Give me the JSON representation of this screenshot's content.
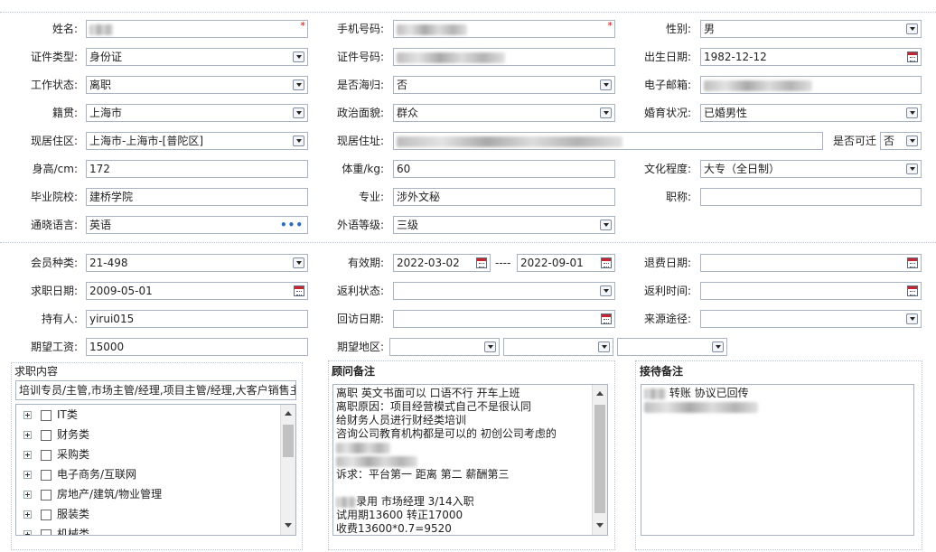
{
  "personal": {
    "name": {
      "label": "姓名:",
      "required_mark": "*"
    },
    "phone": {
      "label": "手机号码:",
      "required_mark": "*"
    },
    "gender": {
      "label": "性别:",
      "value": "男"
    },
    "id_type": {
      "label": "证件类型:",
      "value": "身份证"
    },
    "id_number": {
      "label": "证件号码:"
    },
    "birth_date": {
      "label": "出生日期:",
      "value": "1982-12-12"
    },
    "work_status": {
      "label": "工作状态:",
      "value": "离职"
    },
    "overseas_return": {
      "label": "是否海归:",
      "value": "否"
    },
    "email": {
      "label": "电子邮箱:"
    },
    "native_place": {
      "label": "籍贯:",
      "value": "上海市"
    },
    "political": {
      "label": "政治面貌:",
      "value": "群众"
    },
    "marital": {
      "label": "婚育状况:",
      "value": "已婚男性"
    },
    "residence_area": {
      "label": "现居住区:",
      "value": "上海市-上海市-[普陀区]"
    },
    "residence_address": {
      "label": "现居住址:"
    },
    "relocatable": {
      "label": "是否可迁",
      "value": "否"
    },
    "height": {
      "label": "身高/cm:",
      "value": "172"
    },
    "weight": {
      "label": "体重/kg:",
      "value": "60"
    },
    "education": {
      "label": "文化程度:",
      "value": "大专（全日制）"
    },
    "school": {
      "label": "毕业院校:",
      "value": "建桥学院"
    },
    "major": {
      "label": "专业:",
      "value": "涉外文秘"
    },
    "title": {
      "label": "职称:",
      "value": ""
    },
    "language": {
      "label": "通晓语言:",
      "value": "英语"
    },
    "language_level": {
      "label": "外语等级:",
      "value": "三级"
    }
  },
  "membership": {
    "member_type": {
      "label": "会员种类:",
      "value": "21-498"
    },
    "validity": {
      "label": "有效期:",
      "start": "2022-03-02",
      "separator": "----",
      "end": "2022-09-01"
    },
    "refund_date": {
      "label": "退费日期:",
      "value": ""
    },
    "job_date": {
      "label": "求职日期:",
      "value": "2009-05-01"
    },
    "rebate_status": {
      "label": "返利状态:",
      "value": ""
    },
    "rebate_time": {
      "label": "返利时间:",
      "value": ""
    },
    "holder": {
      "label": "持有人:",
      "value": "yirui015"
    },
    "visit_date": {
      "label": "回访日期:",
      "value": ""
    },
    "source": {
      "label": "来源途径:",
      "value": ""
    },
    "expected_salary": {
      "label": "期望工资:",
      "value": "15000"
    },
    "expected_area": {
      "label": "期望地区:"
    }
  },
  "job_content": {
    "title": "求职内容",
    "summary": "培训专员/主管,市场主管/经理,项目主管/经理,大客户销售主",
    "tree": [
      "IT类",
      "财务类",
      "采购类",
      "电子商务/互联网",
      "房地产/建筑/物业管理",
      "服装类",
      "机械类"
    ]
  },
  "consultant_notes": {
    "title": "顾问备注",
    "lines": [
      "离职 英文书面可以 口语不行  开车上班",
      "离职原因：项目经营模式自己不是很认同",
      "给财务人员进行财经类培训",
      "咨询公司教育机构都是可以的 初创公司考虑的",
      "",
      "",
      "诉求：平台第一 距离 第二 薪酬第三",
      "",
      "录用 市场经理 3/14入职",
      "试用期13600 转正17000",
      "收费13600*0.7=9520"
    ]
  },
  "reception_notes": {
    "title": "接待备注",
    "line1_suffix": "转账 协议已回传"
  },
  "colors": {
    "required": "#dd0000",
    "border": "#a9b4c2",
    "accent": "#2a6ebd"
  }
}
